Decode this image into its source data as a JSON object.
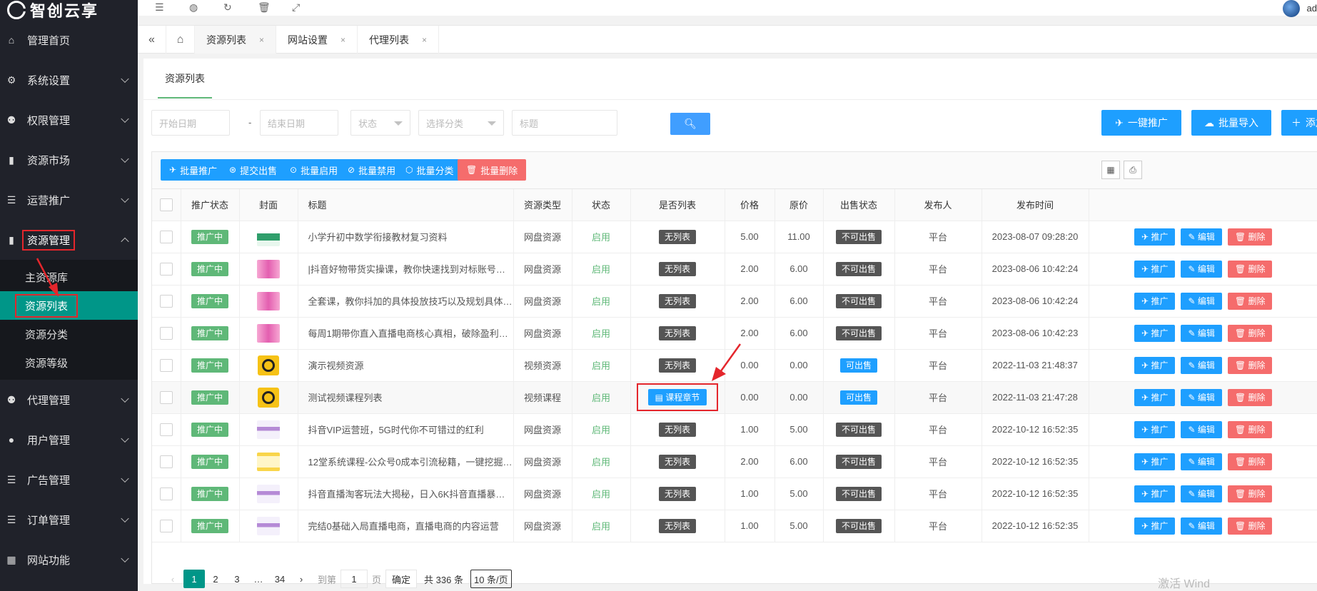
{
  "app": {
    "logo_text": "智创云享",
    "user_name": "ad"
  },
  "header": {
    "icons": [
      "menu-fold-icon",
      "globe-icon",
      "refresh-icon",
      "trash-icon",
      "fullscreen-icon"
    ]
  },
  "tabs": [
    {
      "label": "资源列表",
      "close": "×"
    },
    {
      "label": "网站设置",
      "close": "×"
    },
    {
      "label": "代理列表",
      "close": "×"
    }
  ],
  "sidebar": {
    "items": [
      {
        "label": "管理首页",
        "icon": "home-icon",
        "glyph": "⌂",
        "has_sub": false
      },
      {
        "label": "系统设置",
        "icon": "gear-icon",
        "glyph": "⚙",
        "has_sub": true
      },
      {
        "label": "权限管理",
        "icon": "users-icon",
        "glyph": "⚉",
        "has_sub": true
      },
      {
        "label": "资源市场",
        "icon": "bookmark-icon",
        "glyph": "▮",
        "has_sub": true
      },
      {
        "label": "运营推广",
        "icon": "list-icon",
        "glyph": "☰",
        "has_sub": true
      },
      {
        "label": "资源管理",
        "icon": "bookmark-icon",
        "glyph": "▮",
        "has_sub": true,
        "expanded": true
      }
    ],
    "sub_items": [
      "主资源库",
      "资源列表",
      "资源分类",
      "资源等级"
    ],
    "items_after": [
      {
        "label": "代理管理",
        "icon": "users-icon",
        "glyph": "⚉"
      },
      {
        "label": "用户管理",
        "icon": "user-icon",
        "glyph": "●"
      },
      {
        "label": "广告管理",
        "icon": "list-icon",
        "glyph": "☰"
      },
      {
        "label": "订单管理",
        "icon": "list-icon",
        "glyph": "☰"
      },
      {
        "label": "网站功能",
        "icon": "grid-icon",
        "glyph": "▦"
      }
    ]
  },
  "page": {
    "card_tab": "资源列表"
  },
  "filters": {
    "start_date": "开始日期",
    "dash": "-",
    "end_date": "结束日期",
    "status": "状态",
    "category": "选择分类",
    "title": "标题"
  },
  "actions": {
    "promote_one": "一键推广",
    "batch_import": "批量导入",
    "add": "添加"
  },
  "toolbar": {
    "batch_promote": "批量推广",
    "submit_sale": "提交出售",
    "batch_enable": "批量启用",
    "batch_disable": "批量禁用",
    "batch_category": "批量分类",
    "batch_delete": "批量删除"
  },
  "table": {
    "columns": [
      "推广状态",
      "封面",
      "标题",
      "资源类型",
      "状态",
      "是否列表",
      "价格",
      "原价",
      "出售状态",
      "发布人",
      "发布时间"
    ],
    "rows": [
      {
        "promo": "推广中",
        "cover": "banner-green",
        "title": "小学升初中数学衔接教材复习资料",
        "type": "网盘资源",
        "status": "启用",
        "list": "无列表",
        "price": "5.00",
        "orig": "11.00",
        "sale": "不可出售",
        "publisher": "平台",
        "time": "2023-08-07 09:28:20"
      },
      {
        "promo": "推广中",
        "cover": "banner-pink",
        "title": "|抖音好物带货实操课，教你快速找到对标账号的…",
        "type": "网盘资源",
        "status": "启用",
        "list": "无列表",
        "price": "2.00",
        "orig": "6.00",
        "sale": "不可出售",
        "publisher": "平台",
        "time": "2023-08-06 10:42:24"
      },
      {
        "promo": "推广中",
        "cover": "banner-pink",
        "title": "全套课，教你抖加的具体投放技巧以及规划具体…",
        "type": "网盘资源",
        "status": "启用",
        "list": "无列表",
        "price": "2.00",
        "orig": "6.00",
        "sale": "不可出售",
        "publisher": "平台",
        "time": "2023-08-06 10:42:24"
      },
      {
        "promo": "推广中",
        "cover": "banner-pink",
        "title": "每周1期带你直入直播电商核心真相，破除盈利…",
        "type": "网盘资源",
        "status": "启用",
        "list": "无列表",
        "price": "2.00",
        "orig": "6.00",
        "sale": "不可出售",
        "publisher": "平台",
        "time": "2023-08-06 10:42:23"
      },
      {
        "promo": "推广中",
        "cover": "logo",
        "title": "演示视频资源",
        "type": "视频资源",
        "status": "启用",
        "list": "无列表",
        "price": "0.00",
        "orig": "0.00",
        "sale": "可出售",
        "publisher": "平台",
        "time": "2022-11-03 21:48:37"
      },
      {
        "promo": "推广中",
        "cover": "logo",
        "title": "测试视频课程列表",
        "type": "视频课程",
        "status": "启用",
        "list": "课程章节",
        "price": "0.00",
        "orig": "0.00",
        "sale": "可出售",
        "publisher": "平台",
        "time": "2022-11-03 21:47:28"
      },
      {
        "promo": "推广中",
        "cover": "banner-light",
        "title": "抖音VIP运营班，5G时代你不可错过的红利",
        "type": "网盘资源",
        "status": "启用",
        "list": "无列表",
        "price": "1.00",
        "orig": "5.00",
        "sale": "不可出售",
        "publisher": "平台",
        "time": "2022-10-12 16:52:35"
      },
      {
        "promo": "推广中",
        "cover": "banner-yellow",
        "title": "12堂系统课程-公众号0成本引流秘籍，一键挖掘…",
        "type": "网盘资源",
        "status": "启用",
        "list": "无列表",
        "price": "2.00",
        "orig": "6.00",
        "sale": "不可出售",
        "publisher": "平台",
        "time": "2022-10-12 16:52:35"
      },
      {
        "promo": "推广中",
        "cover": "banner-light",
        "title": "抖音直播淘客玩法大揭秘，日入6K抖音直播暴力…",
        "type": "网盘资源",
        "status": "启用",
        "list": "无列表",
        "price": "1.00",
        "orig": "5.00",
        "sale": "不可出售",
        "publisher": "平台",
        "time": "2022-10-12 16:52:35"
      },
      {
        "promo": "推广中",
        "cover": "banner-light",
        "title": "完结0基础入局直播电商，直播电商的内容运营",
        "type": "网盘资源",
        "status": "启用",
        "list": "无列表",
        "price": "1.00",
        "orig": "5.00",
        "sale": "不可出售",
        "publisher": "平台",
        "time": "2022-10-12 16:52:35"
      }
    ],
    "ops": {
      "promote": "推广",
      "edit": "编辑",
      "delete": "删除"
    }
  },
  "pagination": {
    "pages": [
      "1",
      "2",
      "3",
      "…",
      "34"
    ],
    "goto_label": "到第",
    "goto_value": "1",
    "page_unit": "页",
    "confirm": "确定",
    "total": "共 336 条",
    "per_page": "10 条/页"
  },
  "watermark": "激活 Wind",
  "colors": {
    "sidebar_bg": "#20222a",
    "active_teal": "#009688",
    "primary_blue": "#1e9fff",
    "success_green": "#5fb878",
    "danger_red": "#f56c6c",
    "annotation_red": "#e4262c"
  }
}
